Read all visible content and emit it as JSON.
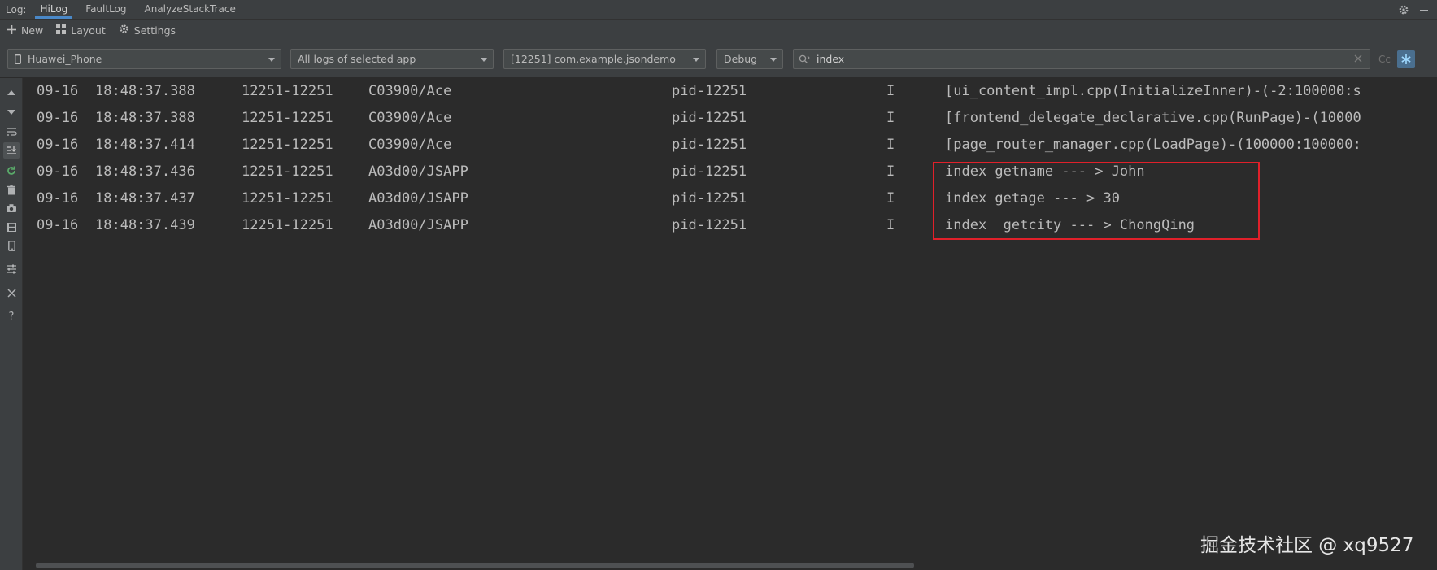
{
  "tabbar": {
    "prefix": "Log:",
    "tabs": [
      {
        "label": "HiLog",
        "active": true
      },
      {
        "label": "FaultLog",
        "active": false
      },
      {
        "label": "AnalyzeStackTrace",
        "active": false
      }
    ]
  },
  "actionbar": {
    "new_label": "New",
    "layout_label": "Layout",
    "settings_label": "Settings"
  },
  "filters": {
    "device": "Huawei_Phone",
    "log_scope": "All logs of selected app",
    "process": "[12251] com.example.jsondemo",
    "level": "Debug",
    "search_value": "index",
    "case_label": "Cc"
  },
  "logs": [
    {
      "date": "09-16",
      "time": "18:48:37.388",
      "pidtid": "12251-12251",
      "tag": "C03900/Ace",
      "pid": "pid-12251",
      "level": "I",
      "message": "[ui_content_impl.cpp(InitializeInner)-(-2:100000:s"
    },
    {
      "date": "09-16",
      "time": "18:48:37.388",
      "pidtid": "12251-12251",
      "tag": "C03900/Ace",
      "pid": "pid-12251",
      "level": "I",
      "message": "[frontend_delegate_declarative.cpp(RunPage)-(10000"
    },
    {
      "date": "09-16",
      "time": "18:48:37.414",
      "pidtid": "12251-12251",
      "tag": "C03900/Ace",
      "pid": "pid-12251",
      "level": "I",
      "message": "[page_router_manager.cpp(LoadPage)-(100000:100000:"
    },
    {
      "date": "09-16",
      "time": "18:48:37.436",
      "pidtid": "12251-12251",
      "tag": "A03d00/JSAPP",
      "pid": "pid-12251",
      "level": "I",
      "message": "index getname --- > John"
    },
    {
      "date": "09-16",
      "time": "18:48:37.437",
      "pidtid": "12251-12251",
      "tag": "A03d00/JSAPP",
      "pid": "pid-12251",
      "level": "I",
      "message": "index getage --- > 30"
    },
    {
      "date": "09-16",
      "time": "18:48:37.439",
      "pidtid": "12251-12251",
      "tag": "A03d00/JSAPP",
      "pid": "pid-12251",
      "level": "I",
      "message": "index  getcity --- > ChongQing"
    }
  ],
  "watermark": "掘金技术社区 @ xq9527",
  "colors": {
    "highlight_border": "#e0202a",
    "active_tab_underline": "#4a88c7",
    "background": "#2b2b2b"
  }
}
